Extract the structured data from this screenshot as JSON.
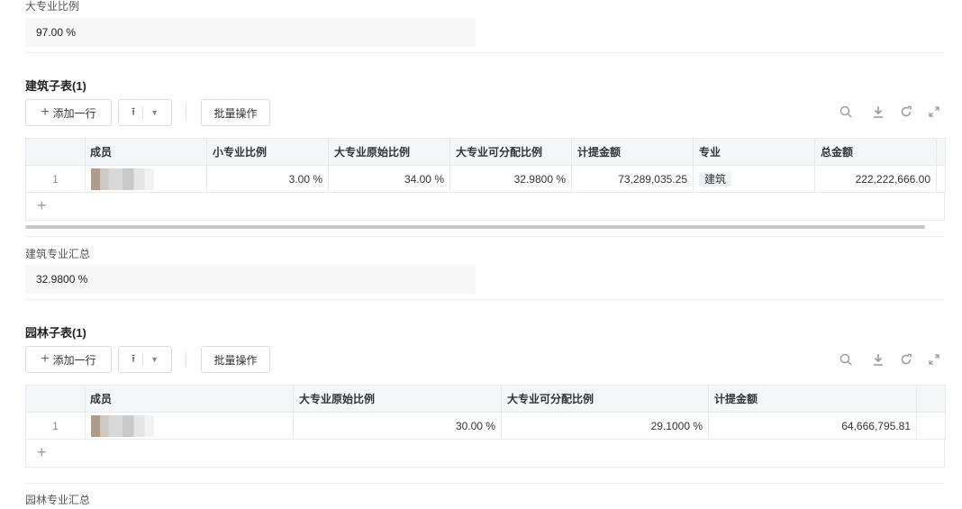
{
  "section1": {
    "label": "大专业比例",
    "value": "97.00 %"
  },
  "table1": {
    "title": "建筑子表(1)",
    "add_row": "添加一行",
    "batch": "批量操作",
    "headers": [
      "成员",
      "小专业比例",
      "大专业原始比例",
      "大专业可分配比例",
      "计提金额",
      "专业",
      "总金额"
    ],
    "rows": [
      {
        "index": "1",
        "small_ratio": "3.00 %",
        "orig_ratio": "34.00 %",
        "alloc_ratio": "32.9800 %",
        "amount": "73,289,035.25",
        "major": "建筑",
        "total": "222,222,666.00"
      }
    ],
    "add_symbol": "+"
  },
  "section2": {
    "label": "建筑专业汇总",
    "value": "32.9800 %"
  },
  "table2": {
    "title": "园林子表(1)",
    "add_row": "添加一行",
    "batch": "批量操作",
    "headers": [
      "成员",
      "大专业原始比例",
      "大专业可分配比例",
      "计提金额"
    ],
    "rows": [
      {
        "index": "1",
        "orig_ratio": "30.00 %",
        "alloc_ratio": "29.1000 %",
        "amount": "64,666,795.81"
      }
    ],
    "add_symbol": "+"
  },
  "section3": {
    "label": "园林专业汇总"
  },
  "icons": {
    "search": "search-icon",
    "download": "download-icon",
    "refresh": "refresh-icon",
    "fullscreen": "fullscreen-icon",
    "upload": "upload-icon",
    "caret": "caret-down-icon"
  }
}
